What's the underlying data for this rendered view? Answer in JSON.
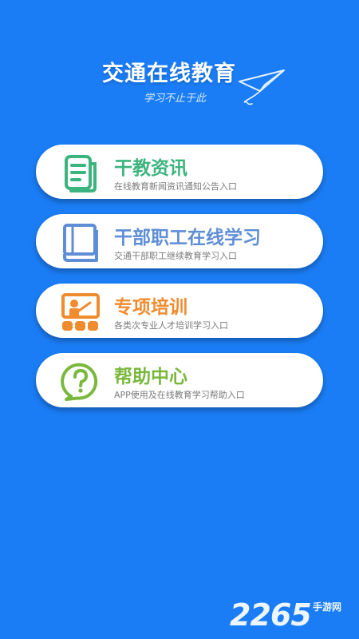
{
  "app": {
    "title": "交通在线教育",
    "slogan": "学习不止于此"
  },
  "menu": {
    "items": [
      {
        "title": "干教资讯",
        "subtitle": "在线教育新闻资讯通知公告入口",
        "icon": "news-document-icon",
        "color": "#3cb47e"
      },
      {
        "title": "干部职工在线学习",
        "subtitle": "交通干部职工继续教育学习入口",
        "icon": "book-icon",
        "color": "#5f8ed6"
      },
      {
        "title": "专项培训",
        "subtitle": "各类次专业人才培训学习入口",
        "icon": "classroom-training-icon",
        "color": "#f08b2e"
      },
      {
        "title": "帮助中心",
        "subtitle": "APP使用及在线教育学习帮助入口",
        "icon": "help-question-icon",
        "color": "#79b83d"
      }
    ]
  },
  "watermark": {
    "number": "2265",
    "text": "手游网"
  },
  "colors": {
    "background": "#1b7df5",
    "card": "#ffffff"
  }
}
